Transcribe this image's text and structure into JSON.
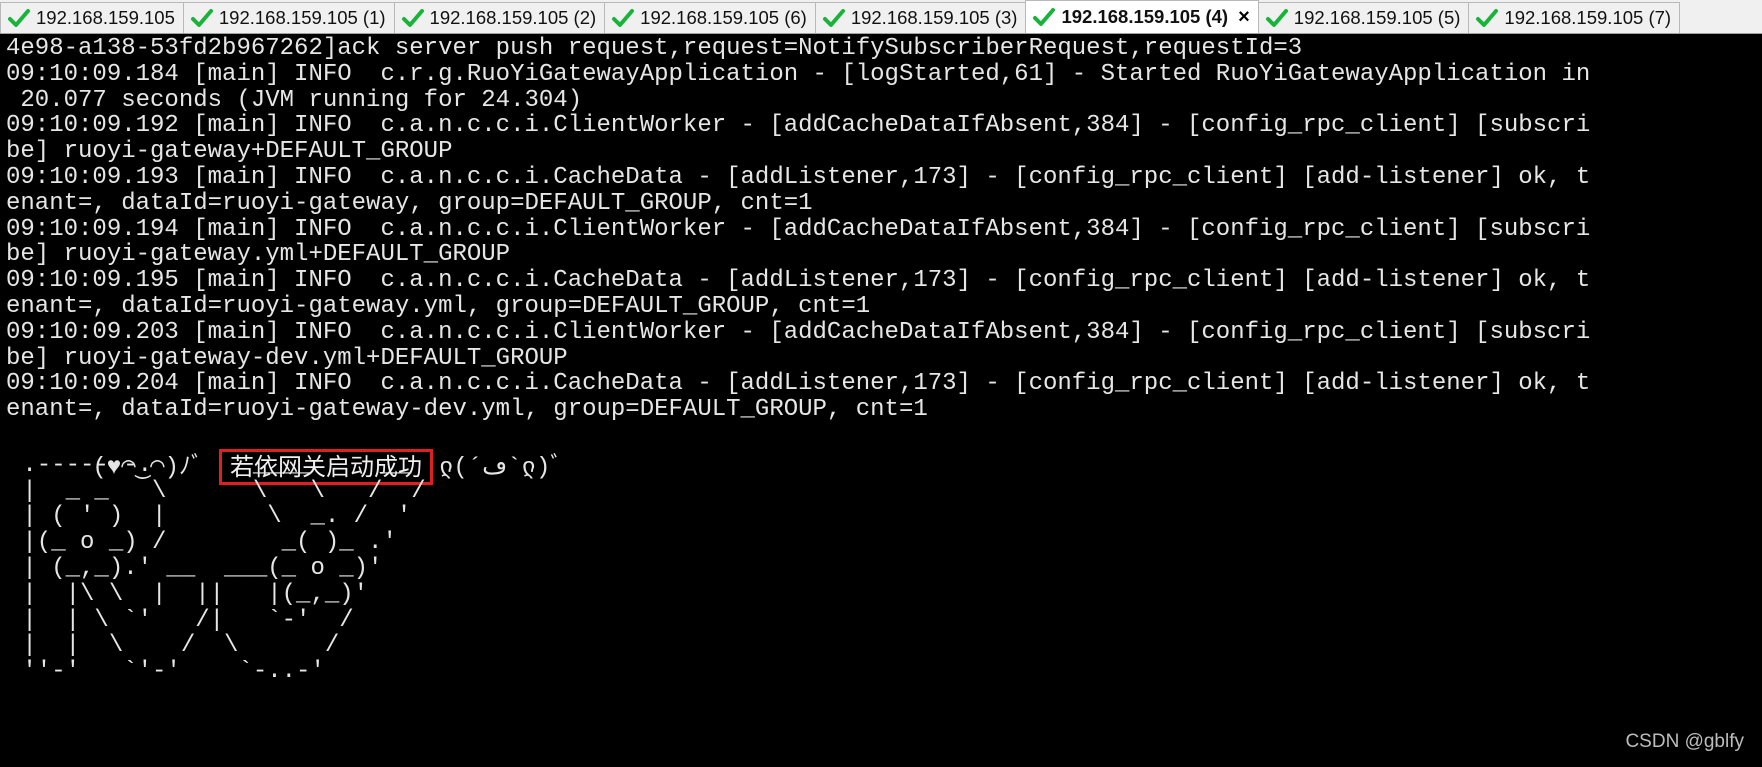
{
  "tabs": [
    {
      "label": "192.168.159.105",
      "active": false
    },
    {
      "label": "192.168.159.105 (1)",
      "active": false
    },
    {
      "label": "192.168.159.105 (2)",
      "active": false
    },
    {
      "label": "192.168.159.105 (6)",
      "active": false
    },
    {
      "label": "192.168.159.105 (3)",
      "active": false
    },
    {
      "label": "192.168.159.105 (4)",
      "active": true,
      "close": "×"
    },
    {
      "label": "192.168.159.105 (5)",
      "active": false
    },
    {
      "label": "192.168.159.105 (7)",
      "active": false
    }
  ],
  "colors": {
    "check": "#19b33b",
    "highlight_box": "#e02020",
    "terminal_bg": "#000000",
    "terminal_fg": "#e6e6e6"
  },
  "terminal": {
    "lines": [
      "4e98-a138-53fd2b967262]ack server push request,request=NotifySubscriberRequest,requestId=3",
      "09:10:09.184 [main] INFO  c.r.g.RuoYiGatewayApplication - [logStarted,61] - Started RuoYiGatewayApplication in",
      " 20.077 seconds (JVM running for 24.304)",
      "09:10:09.192 [main] INFO  c.a.n.c.c.i.ClientWorker - [addCacheDataIfAbsent,384] - [config_rpc_client] [subscri",
      "be] ruoyi-gateway+DEFAULT_GROUP",
      "09:10:09.193 [main] INFO  c.a.n.c.c.i.CacheData - [addListener,173] - [config_rpc_client] [add-listener] ok, t",
      "enant=, dataId=ruoyi-gateway, group=DEFAULT_GROUP, cnt=1",
      "09:10:09.194 [main] INFO  c.a.n.c.c.i.ClientWorker - [addCacheDataIfAbsent,384] - [config_rpc_client] [subscri",
      "be] ruoyi-gateway.yml+DEFAULT_GROUP",
      "09:10:09.195 [main] INFO  c.a.n.c.c.i.CacheData - [addListener,173] - [config_rpc_client] [add-listener] ok, t",
      "enant=, dataId=ruoyi-gateway.yml, group=DEFAULT_GROUP, cnt=1",
      "09:10:09.203 [main] INFO  c.a.n.c.c.i.ClientWorker - [addCacheDataIfAbsent,384] - [config_rpc_client] [subscri",
      "be] ruoyi-gateway-dev.yml+DEFAULT_GROUP",
      "09:10:09.204 [main] INFO  c.a.n.c.c.i.CacheData - [addListener,173] - [config_rpc_client] [add-listener] ok, t",
      "enant=, dataId=ruoyi-gateway-dev.yml, group=DEFAULT_GROUP, cnt=1"
    ],
    "success_line": {
      "prefix": "(♥◠‿◠)ﾉﾞ",
      "message": "若依网关启动成功",
      "suffix": "ლ(´ڡ`ლ)ﾞ"
    },
    "ascii_art": [
      " .-------.       ____     __",
      " |  _ _   \\      \\   \\   /  /",
      " | ( ' )  |       \\  _. /  '",
      " |(_ o _) /        _( )_ .'",
      " | (_,_).' __  ___(_ o _)'",
      " |  |\\ \\  |  ||   |(_,_)'",
      " |  | \\ `'   /|   `-'  /",
      " |  |  \\    /  \\      /",
      " ''-'   `'-'    `-..-'"
    ]
  },
  "watermark": "CSDN @gblfy"
}
